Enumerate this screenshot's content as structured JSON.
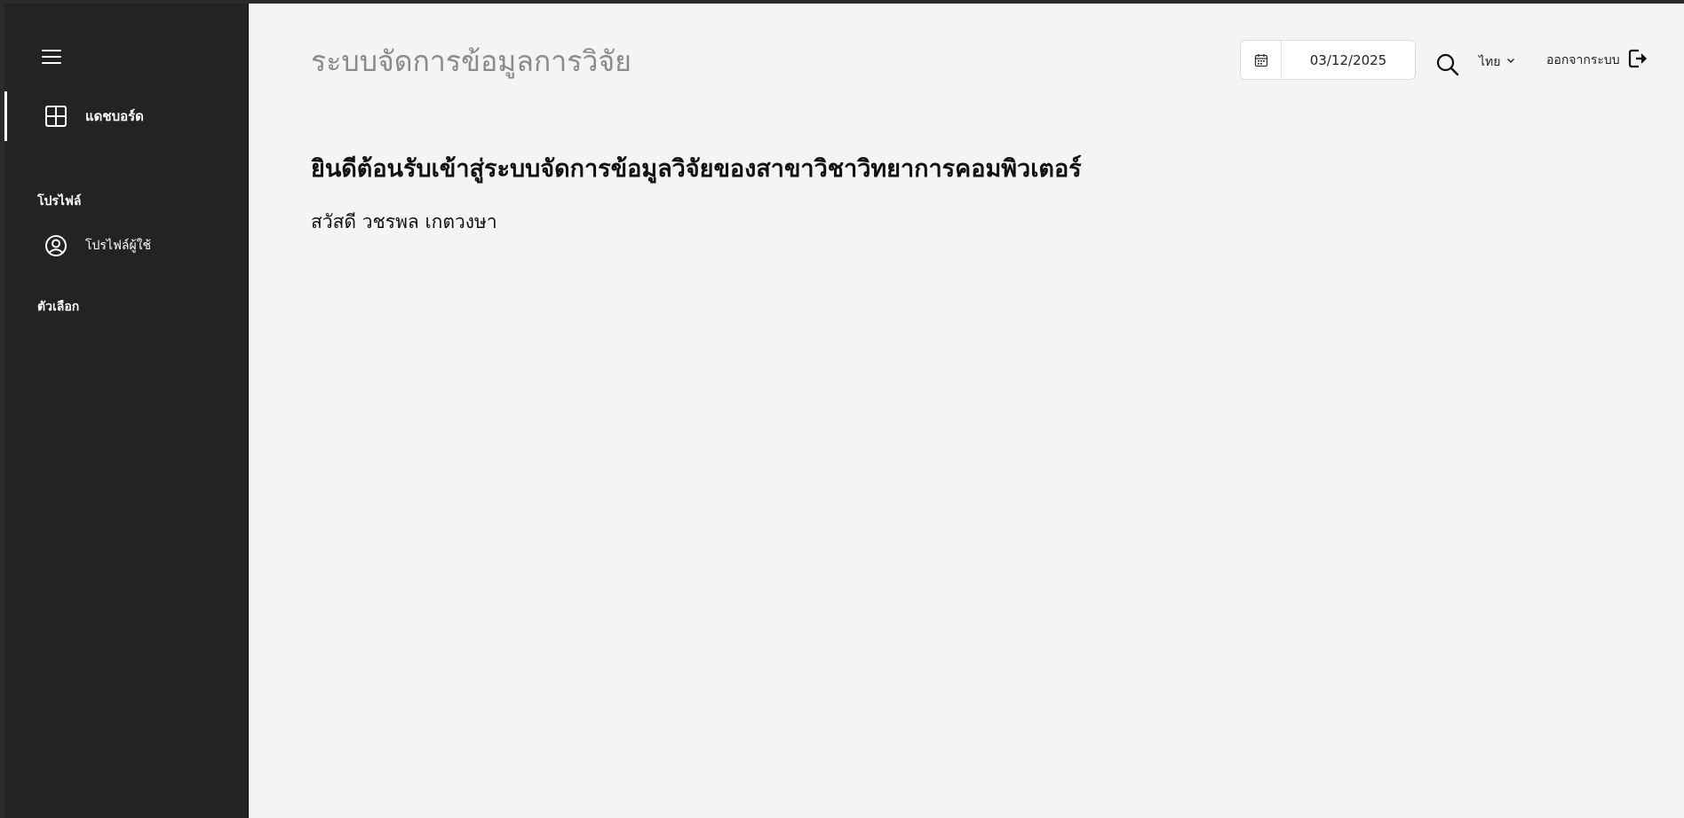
{
  "sidebar": {
    "menu_icon": "hamburger-icon",
    "items": [
      {
        "label": "แดชบอร์ด",
        "icon": "dashboard-grid-icon",
        "active": true
      }
    ],
    "section_profile": "โปรไฟล์",
    "profile_item": {
      "label": "โปรไฟล์ผู้ใช้",
      "icon": "user-circle-icon"
    },
    "section_options": "ตัวเลือก"
  },
  "header": {
    "title": "ระบบจัดการข้อมูลการวิจัย",
    "date_value": "03/12/2025",
    "search_icon": "search-icon",
    "language": "ไทย",
    "logout_label": "ออกจากระบบ"
  },
  "main": {
    "welcome": "ยินดีต้อนรับเข้าสู่ระบบจัดการข้อมูลวิจัยของสาขาวิชาวิทยาการคอมพิวเตอร์",
    "greeting": "สวัสดี วชรพล เกตวงษา"
  },
  "colors": {
    "sidebar_bg": "#232326",
    "main_bg": "#f3f4f6",
    "title_gray": "#8a8a8a"
  }
}
